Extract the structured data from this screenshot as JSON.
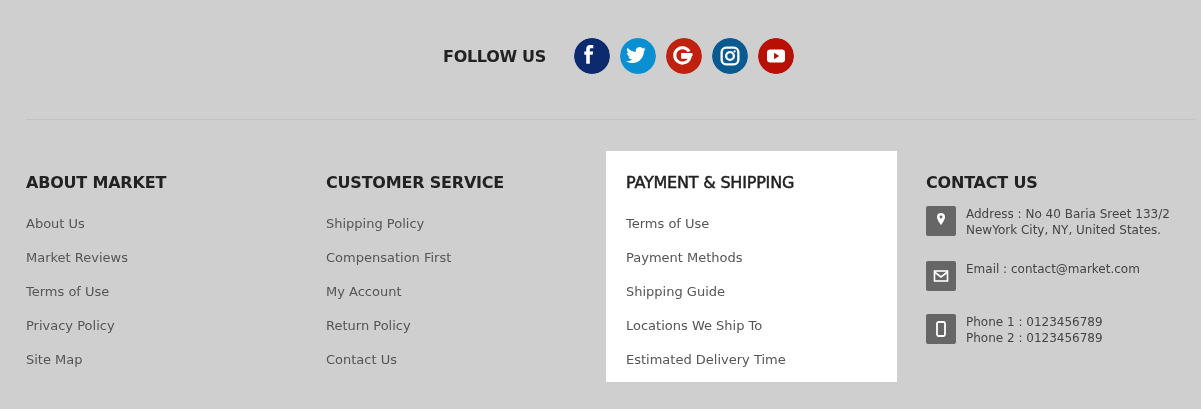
{
  "follow": {
    "label": "FOLLOW US",
    "networks": [
      {
        "kind": "facebook",
        "color": "#0e2a6e"
      },
      {
        "kind": "twitter",
        "color": "#0b8fd3"
      },
      {
        "kind": "google",
        "color": "#c0200e"
      },
      {
        "kind": "instagram",
        "color": "#0a5a92"
      },
      {
        "kind": "youtube",
        "color": "#b81005"
      }
    ]
  },
  "columns": [
    {
      "title": "ABOUT MARKET",
      "highlighted": false,
      "links": [
        "About Us",
        "Market Reviews",
        "Terms of Use",
        "Privacy Policy",
        "Site Map"
      ]
    },
    {
      "title": "CUSTOMER SERVICE",
      "highlighted": false,
      "links": [
        "Shipping Policy",
        "Compensation First",
        "My Account",
        "Return Policy",
        "Contact Us"
      ]
    },
    {
      "title": "PAYMENT & SHIPPING",
      "highlighted": true,
      "links": [
        "Terms of Use",
        "Payment Methods",
        "Shipping Guide",
        "Locations We Ship To",
        "Estimated Delivery Time"
      ]
    }
  ],
  "contact": {
    "title": "CONTACT US",
    "items": [
      {
        "kind": "address",
        "lines": [
          "Address : No 40 Baria Sreet 133/2",
          "NewYork City, NY, United States."
        ]
      },
      {
        "kind": "email",
        "lines": [
          "Email : contact@market.com"
        ]
      },
      {
        "kind": "phone",
        "lines": [
          "Phone 1 : 0123456789",
          "Phone 2 : 0123456789"
        ]
      }
    ]
  }
}
